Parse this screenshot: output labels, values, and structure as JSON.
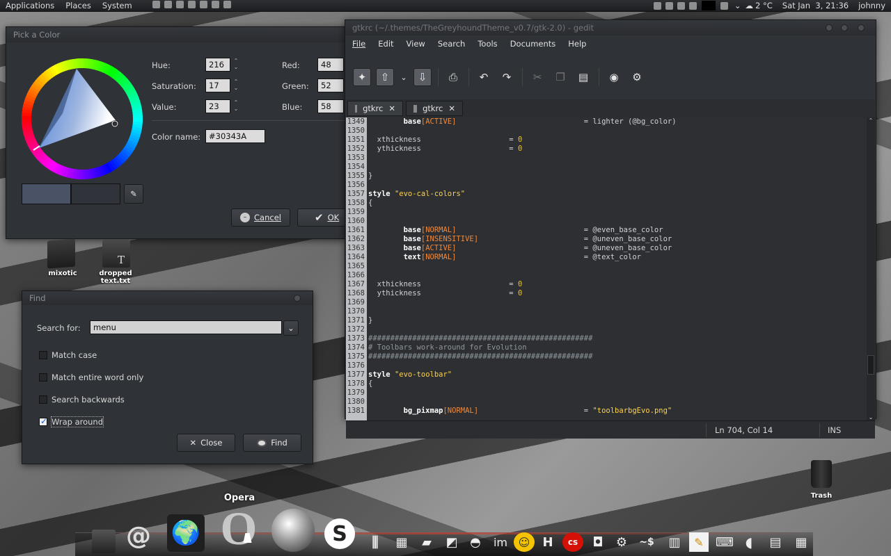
{
  "top_panel": {
    "menus": [
      "Applications",
      "Places",
      "System"
    ],
    "weather": "2 °C",
    "clock": "Sat Jan  3, 21:36",
    "user": "johnny"
  },
  "color_dialog": {
    "title": "Pick a Color",
    "hue_label": "Hue:",
    "hue": "216",
    "saturation_label": "Saturation:",
    "saturation": "17",
    "value_label": "Value:",
    "value": "23",
    "red_label": "Red:",
    "red": "48",
    "green_label": "Green:",
    "green": "52",
    "blue_label": "Blue:",
    "blue": "58",
    "color_name_label": "Color name:",
    "color_name": "#30343A",
    "cancel": "Cancel",
    "ok": "OK",
    "current_color": "#4a5266",
    "previous_color": "#30343a"
  },
  "desktop_icons": [
    {
      "label": "mixotic"
    },
    {
      "label": "dropped text.txt"
    },
    {
      "label": "Trash"
    }
  ],
  "find_dialog": {
    "title": "Find",
    "search_label": "Search for:",
    "search_value": "menu",
    "options": [
      {
        "label": "Match case",
        "checked": false
      },
      {
        "label": "Match entire word only",
        "checked": false
      },
      {
        "label": "Search backwards",
        "checked": false
      },
      {
        "label": "Wrap around",
        "checked": true
      }
    ],
    "close": "Close",
    "find": "Find"
  },
  "gedit": {
    "title": "gtkrc (~/.themes/TheGreyhoundTheme_v0.7/gtk-2.0) - gedit",
    "menus": [
      "File",
      "Edit",
      "View",
      "Search",
      "Tools",
      "Documents",
      "Help"
    ],
    "tabs": [
      {
        "label": "gtkrc"
      },
      {
        "label": "gtkrc"
      }
    ],
    "status_position": "Ln 704, Col 14",
    "status_mode": "INS",
    "line_numbers": [
      "1349",
      "1350",
      "1351",
      "1352",
      "1353",
      "1354",
      "1355",
      "1356",
      "1357",
      "1358",
      "1359",
      "1360",
      "1361",
      "1362",
      "1363",
      "1364",
      "1365",
      "1366",
      "1367",
      "1368",
      "1369",
      "1370",
      "1371",
      "1372",
      "1373",
      "1374",
      "1375",
      "1376",
      "1377",
      "1378",
      "1379",
      "1380",
      "1381"
    ],
    "code": [
      {
        "pre": "        ",
        "kw": "base",
        "br": "[ACTIVE]",
        "pad": "                             ",
        "rest": "= lighter (@bg_color)"
      },
      {
        "text": ""
      },
      {
        "pre": "  xthickness                    ",
        "rest": "= ",
        "num": "0"
      },
      {
        "pre": "  ythickness                    ",
        "rest": "= ",
        "num": "0"
      },
      {
        "text": ""
      },
      {
        "text": ""
      },
      {
        "text": "}"
      },
      {
        "text": ""
      },
      {
        "kw": "style",
        "rest": " ",
        "str": "\"evo-cal-colors\""
      },
      {
        "text": "{"
      },
      {
        "text": ""
      },
      {
        "text": ""
      },
      {
        "pre": "        ",
        "kw": "base",
        "br": "[NORMAL]",
        "pad": "                             ",
        "rest": "= @even_base_color"
      },
      {
        "pre": "        ",
        "kw": "base",
        "br": "[INSENSITIVE]",
        "pad": "                        ",
        "rest": "= @uneven_base_color"
      },
      {
        "pre": "        ",
        "kw": "base",
        "br": "[ACTIVE]",
        "pad": "                             ",
        "rest": "= @uneven_base_color"
      },
      {
        "pre": "        ",
        "kw": "text",
        "br": "[NORMAL]",
        "pad": "                             ",
        "rest": "= @text_color"
      },
      {
        "text": ""
      },
      {
        "text": ""
      },
      {
        "pre": "  xthickness                    ",
        "rest": "= ",
        "num": "0"
      },
      {
        "pre": "  ythickness                    ",
        "rest": "= ",
        "num": "0"
      },
      {
        "text": ""
      },
      {
        "text": ""
      },
      {
        "text": "}"
      },
      {
        "text": ""
      },
      {
        "cm": "###################################################"
      },
      {
        "cm": "# Toolbars work-around for Evolution"
      },
      {
        "cm": "###################################################"
      },
      {
        "text": ""
      },
      {
        "kw": "style",
        "rest": " ",
        "str": "\"evo-toolbar\""
      },
      {
        "text": "{"
      },
      {
        "text": ""
      },
      {
        "text": ""
      },
      {
        "pre": "        ",
        "kw": "bg_pixmap",
        "br": "[NORMAL]",
        "pad": "                        ",
        "rest": "= ",
        "str": "\"toolbarbgEvo.png\""
      }
    ]
  },
  "dock": {
    "tooltip": "Opera"
  }
}
